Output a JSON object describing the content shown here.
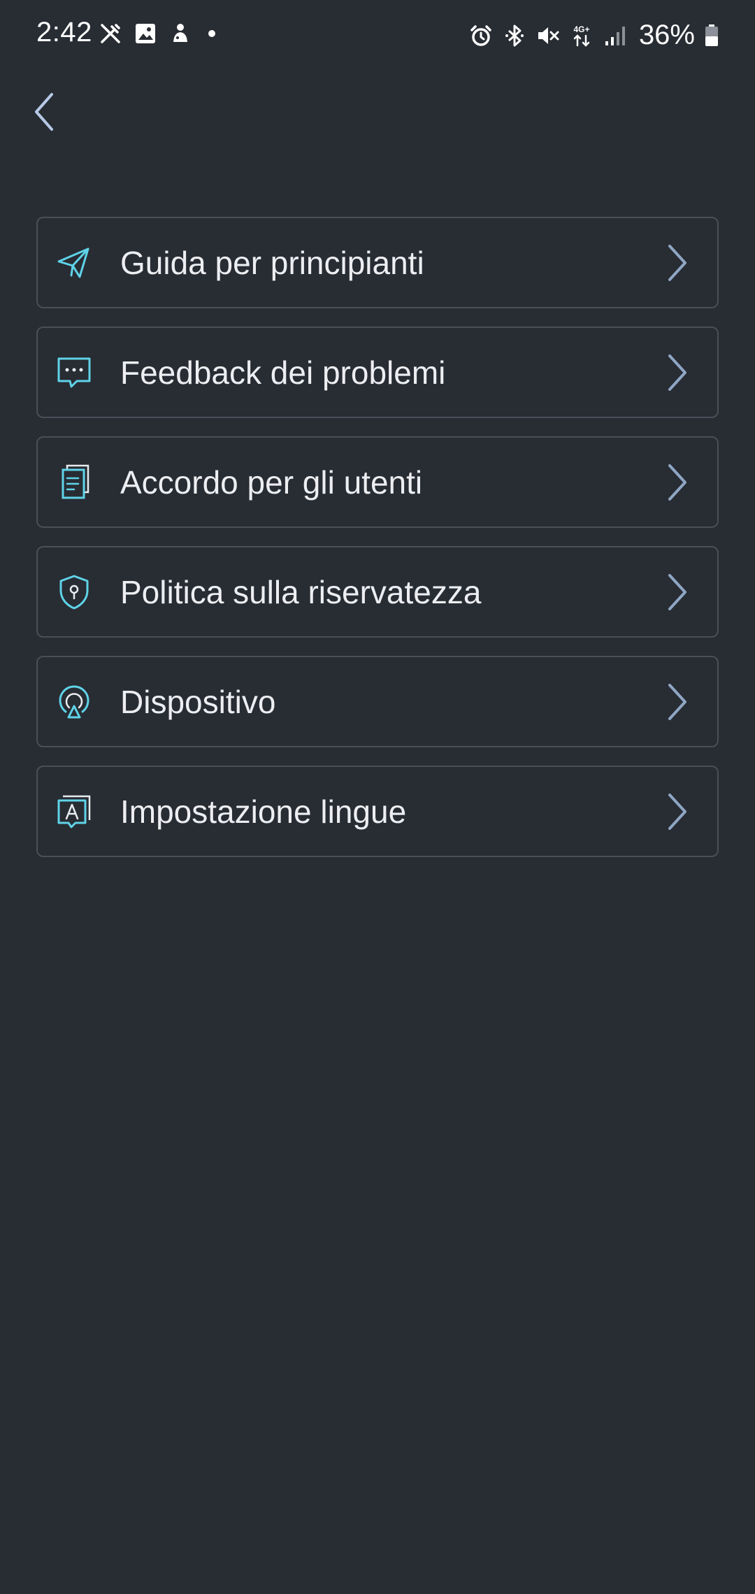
{
  "status_bar": {
    "time": "2:42",
    "battery_percent": "36%",
    "left_icons": [
      "edit-off-icon",
      "image-icon",
      "app-notification-icon",
      "more-dot-icon"
    ],
    "right_icons": [
      "alarm-icon",
      "bluetooth-icon",
      "mute-icon",
      "4g-data-icon",
      "signal-icon",
      "battery-icon"
    ],
    "network_label": "4G+"
  },
  "nav": {
    "back_icon": "chevron-left-icon"
  },
  "menu": {
    "items": [
      {
        "label": "Guida per principianti",
        "icon": "paper-plane-icon"
      },
      {
        "label": "Feedback dei problemi",
        "icon": "chat-bubble-icon"
      },
      {
        "label": "Accordo per gli utenti",
        "icon": "documents-icon"
      },
      {
        "label": "Politica sulla riservatezza",
        "icon": "shield-lock-icon"
      },
      {
        "label": "Dispositivo",
        "icon": "device-cast-icon"
      },
      {
        "label": "Impostazione lingue",
        "icon": "language-icon"
      }
    ]
  },
  "colors": {
    "background": "#282c33",
    "item_border": "#4a4f58",
    "icon_accent": "#5fd3e8",
    "chevron": "#8fa6c4",
    "text": "#eceef1"
  }
}
